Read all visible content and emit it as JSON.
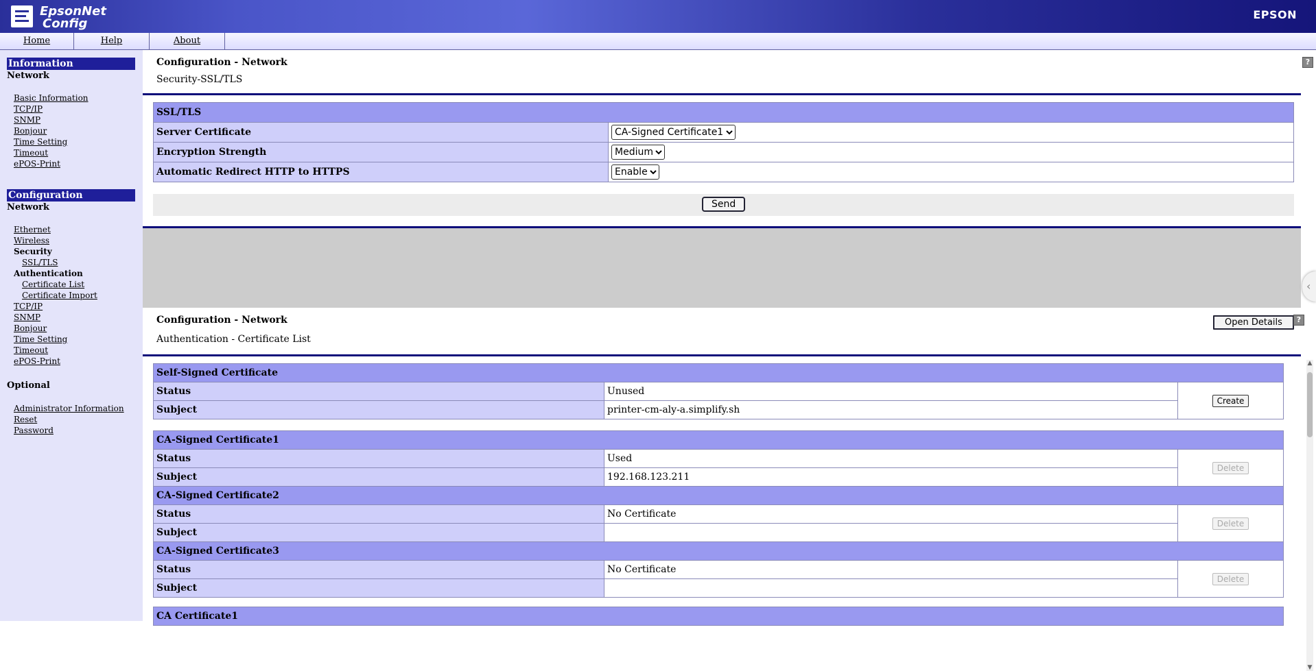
{
  "header": {
    "logo_line1": "EpsonNet",
    "logo_line2": "Config",
    "brand": "EPSON"
  },
  "nav": {
    "home": "Home",
    "help": "Help",
    "about": "About"
  },
  "sidebar": {
    "information_head": "Information",
    "info_network": "Network",
    "info_links": [
      "Basic Information",
      "TCP/IP",
      "SNMP",
      "Bonjour",
      "Time Setting",
      "Timeout",
      "ePOS-Print"
    ],
    "configuration_head": "Configuration",
    "conf_network": "Network",
    "conf_ethernet": "Ethernet",
    "conf_wireless": "Wireless",
    "security_label": "Security",
    "ssl_tls": "SSL/TLS",
    "authentication_label": "Authentication",
    "certificate_list": "Certificate List",
    "certificate_import": "Certificate Import",
    "conf_links": [
      "TCP/IP",
      "SNMP",
      "Bonjour",
      "Time Setting",
      "Timeout",
      "ePOS-Print"
    ],
    "optional_label": "Optional",
    "optional_links": [
      "Administrator Information",
      "Reset",
      "Password"
    ]
  },
  "ssl_section": {
    "title": "Configuration - Network",
    "subtitle": "Security-SSL/TLS",
    "table_head": "SSL/TLS",
    "server_certificate_label": "Server Certificate",
    "server_certificate_value": "CA-Signed Certificate1",
    "encryption_strength_label": "Encryption Strength",
    "encryption_strength_value": "Medium",
    "redirect_label": "Automatic Redirect HTTP to HTTPS",
    "redirect_value": "Enable",
    "send_label": "Send",
    "help": "?"
  },
  "cert_section": {
    "title": "Configuration - Network",
    "subtitle": "Authentication - Certificate List",
    "open_details": "Open Details",
    "help": "?",
    "status_label": "Status",
    "subject_label": "Subject",
    "self_signed": {
      "head": "Self-Signed Certificate",
      "status": "Unused",
      "subject": "printer-cm-aly-a.simplify.sh",
      "action": "Create"
    },
    "ca1": {
      "head": "CA-Signed Certificate1",
      "status": "Used",
      "subject": "192.168.123.211",
      "action": "Delete"
    },
    "ca2": {
      "head": "CA-Signed Certificate2",
      "status": "No Certificate",
      "subject": "",
      "action": "Delete"
    },
    "ca3": {
      "head": "CA-Signed Certificate3",
      "status": "No Certificate",
      "subject": "",
      "action": "Delete"
    },
    "ca_cert1_head": "CA Certificate1"
  },
  "colors": {
    "header_blue": "#2a2f9a",
    "table_head": "#9999f0",
    "table_label": "#cfcffa",
    "rule": "#0b0b7a"
  }
}
